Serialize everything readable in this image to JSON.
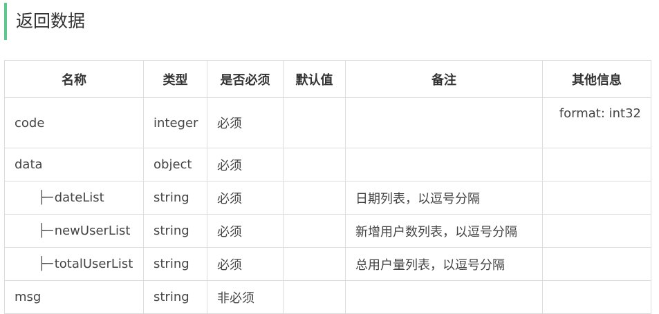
{
  "section": {
    "title": "返回数据"
  },
  "table": {
    "headers": {
      "name": "名称",
      "type": "类型",
      "required": "是否必须",
      "default": "默认值",
      "note": "备注",
      "other": "其他信息"
    },
    "rows": [
      {
        "prefix": "",
        "name": "code",
        "type": "integer",
        "required": "必须",
        "default": "",
        "note": "",
        "other": "format: int32"
      },
      {
        "prefix": "",
        "name": "data",
        "type": "object",
        "required": "必须",
        "default": "",
        "note": "",
        "other": ""
      },
      {
        "prefix": "├─",
        "name": "dateList",
        "type": "string",
        "required": "必须",
        "default": "",
        "note": "日期列表，以逗号分隔",
        "other": ""
      },
      {
        "prefix": "├─",
        "name": "newUserList",
        "type": "string",
        "required": "必须",
        "default": "",
        "note": "新增用户数列表，以逗号分隔",
        "other": ""
      },
      {
        "prefix": "├─",
        "name": "totalUserList",
        "type": "string",
        "required": "必须",
        "default": "",
        "note": "总用户量列表，以逗号分隔",
        "other": ""
      },
      {
        "prefix": "",
        "name": "msg",
        "type": "string",
        "required": "非必须",
        "default": "",
        "note": "",
        "other": ""
      }
    ]
  },
  "colors": {
    "accent": "#5cc78f",
    "border": "#dcdcdc",
    "text": "#333333"
  }
}
